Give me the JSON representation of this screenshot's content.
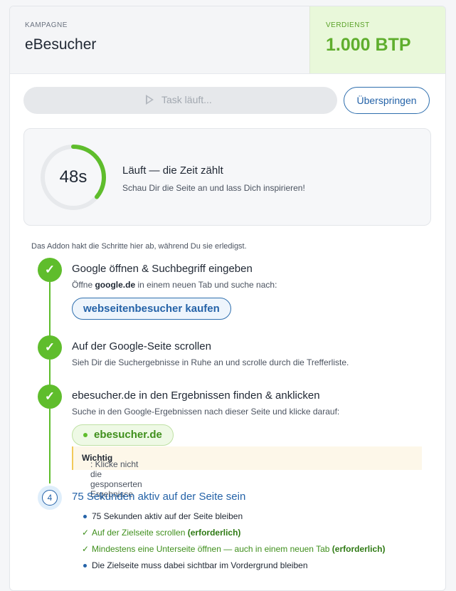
{
  "header": {
    "campaign_caption": "KAMPAGNE",
    "campaign_name": "eBesucher",
    "earnings_caption": "VERDIENST",
    "earnings_value": "1.000 BTP"
  },
  "controls": {
    "run_label": "Task läuft...",
    "skip_label": "Überspringen"
  },
  "timer": {
    "seconds_text": "48s",
    "progress_fraction": 0.36,
    "title": "Läuft — die Zeit zählt",
    "subtitle": "Schau Dir die Seite an und lass Dich inspirieren!"
  },
  "note": "Das Addon hakt die Schritte hier ab, während Du sie erledigst.",
  "steps": [
    {
      "status": "done",
      "title": "Google öffnen & Suchbegriff eingeben",
      "desc_prefix": "Öffne ",
      "desc_bold": "google.de",
      "desc_suffix": " in einem neuen Tab und suche nach:",
      "search_term": "webseitenbesucher kaufen"
    },
    {
      "status": "done",
      "title": "Auf der Google-Seite scrollen",
      "desc": "Sieh Dir die Suchergebnisse in Ruhe an und scrolle durch die Trefferliste."
    },
    {
      "status": "done",
      "title": "ebesucher.de in den Ergebnissen finden & anklicken",
      "desc": "Suche in den Google-Ergebnissen nach dieser Seite und klicke darauf:",
      "target": "ebesucher.de",
      "warning_label": "Wichtig",
      "warning_text": ": Klicke nicht die gesponserten Ergebnisse"
    },
    {
      "status": "active",
      "number": "4",
      "title": "75 Sekunden aktiv auf der Seite sein",
      "items": [
        {
          "type": "dot",
          "text": "75 Sekunden aktiv auf der Seite bleiben",
          "tag": ""
        },
        {
          "type": "ok",
          "text": "Auf der Zielseite scrollen",
          "tag": "(erforderlich)"
        },
        {
          "type": "ok",
          "text": "Mindestens eine Unterseite öffnen — auch in einem neuen Tab",
          "tag": "(erforderlich)"
        },
        {
          "type": "dot",
          "text": "Die Zielseite muss dabei sichtbar im Vordergrund bleiben",
          "tag": ""
        }
      ]
    }
  ],
  "colors": {
    "accent_blue": "#2563a8",
    "success_green": "#5fbd2c",
    "earnings_bg": "#e9f8da",
    "warning_border": "#f2c95a"
  }
}
